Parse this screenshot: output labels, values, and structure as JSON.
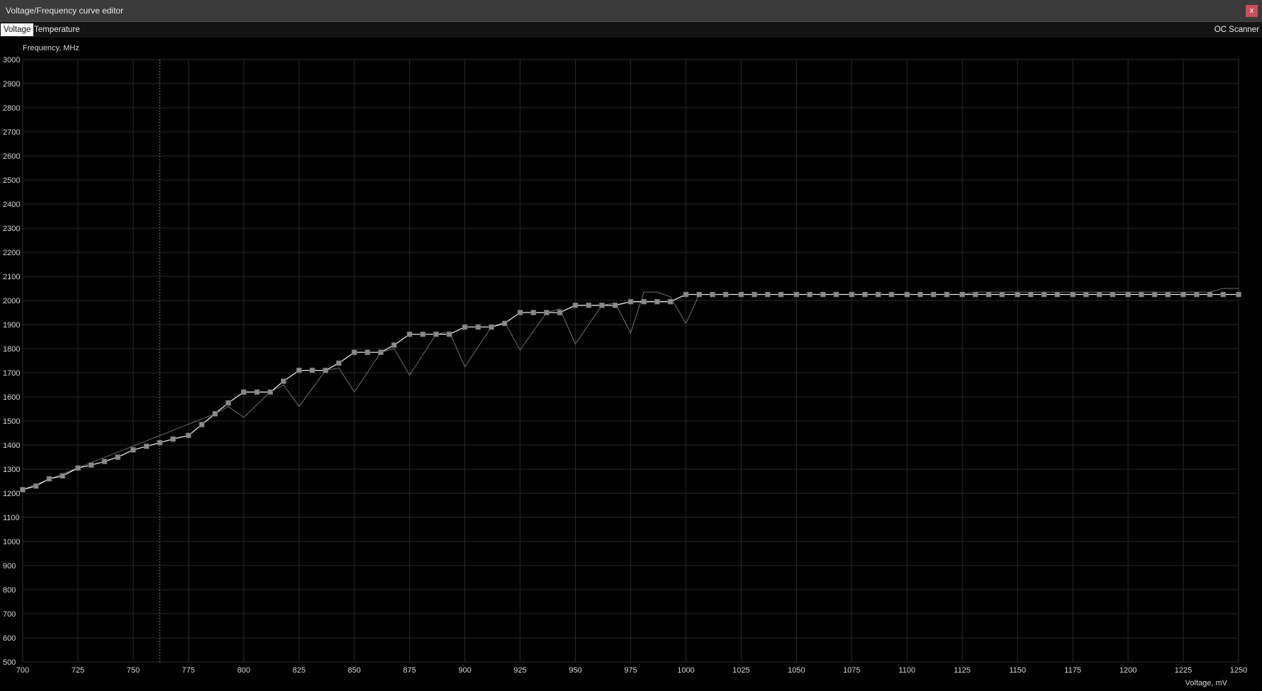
{
  "window": {
    "title": "Voltage/Frequency curve editor",
    "close_label": "x"
  },
  "tabs": [
    {
      "label": "Voltage",
      "active": true
    },
    {
      "label": "Temperature",
      "active": false
    }
  ],
  "oc_scanner_label": "OC Scanner",
  "colors": {
    "background": "#000000",
    "titlebar": "#3b3b3b",
    "close_button": "#c8505a",
    "grid": "#2a2a2a",
    "curve": "#e8e8e8",
    "marker": "#8a8a8a",
    "reference_curve": "#6e6e6e"
  },
  "chart_data": {
    "type": "line",
    "title": "",
    "xlabel": "Voltage, mV",
    "ylabel": "Frequency, MHz",
    "xlim": [
      700,
      1250
    ],
    "ylim": [
      500,
      3000
    ],
    "x_ticks": [
      700,
      725,
      750,
      775,
      800,
      825,
      850,
      875,
      900,
      925,
      950,
      975,
      1000,
      1025,
      1050,
      1075,
      1100,
      1125,
      1150,
      1175,
      1200,
      1225,
      1250
    ],
    "y_ticks": [
      3000,
      2900,
      2800,
      2700,
      2600,
      2500,
      2400,
      2300,
      2200,
      2100,
      2000,
      1900,
      1800,
      1700,
      1600,
      1500,
      1400,
      1300,
      1200,
      1100,
      1000,
      900,
      800,
      700,
      600,
      500
    ],
    "grid": true,
    "cursor_voltage": 762,
    "series": [
      {
        "name": "",
        "role": "curve",
        "markers": true,
        "x": [
          700,
          706,
          712,
          718,
          725,
          731,
          737,
          743,
          750,
          756,
          762,
          768,
          775,
          781,
          787,
          793,
          800,
          806,
          812,
          818,
          825,
          831,
          837,
          843,
          850,
          856,
          862,
          868,
          875,
          881,
          887,
          893,
          900,
          906,
          912,
          918,
          925,
          931,
          937,
          943,
          950,
          956,
          962,
          968,
          975,
          981,
          987,
          993,
          1000,
          1006,
          1012,
          1018,
          1025,
          1031,
          1037,
          1043,
          1050,
          1056,
          1062,
          1068,
          1075,
          1081,
          1087,
          1093,
          1100,
          1106,
          1112,
          1118,
          1125,
          1131,
          1137,
          1143,
          1150,
          1156,
          1162,
          1168,
          1175,
          1181,
          1187,
          1193,
          1200,
          1206,
          1212,
          1218,
          1225,
          1231,
          1237,
          1243,
          1250
        ],
        "y": [
          1215,
          1230,
          1260,
          1272,
          1305,
          1317,
          1332,
          1350,
          1380,
          1395,
          1410,
          1425,
          1440,
          1485,
          1530,
          1575,
          1620,
          1620,
          1620,
          1665,
          1710,
          1710,
          1710,
          1740,
          1785,
          1785,
          1785,
          1815,
          1860,
          1860,
          1860,
          1860,
          1890,
          1890,
          1890,
          1905,
          1950,
          1950,
          1950,
          1950,
          1980,
          1980,
          1980,
          1980,
          1995,
          1995,
          1995,
          1995,
          2025,
          2025,
          2025,
          2025,
          2025,
          2025,
          2025,
          2025,
          2025,
          2025,
          2025,
          2025,
          2025,
          2025,
          2025,
          2025,
          2025,
          2025,
          2025,
          2025,
          2025,
          2025,
          2025,
          2025,
          2025,
          2025,
          2025,
          2025,
          2025,
          2025,
          2025,
          2025,
          2025,
          2025,
          2025,
          2025,
          2025,
          2025,
          2025,
          2025,
          2025
        ]
      },
      {
        "name": "",
        "role": "reference",
        "markers": false,
        "x": [
          700,
          787,
          793,
          800,
          812,
          818,
          825,
          837,
          843,
          850,
          862,
          868,
          875,
          887,
          893,
          900,
          912,
          918,
          925,
          937,
          943,
          950,
          962,
          968,
          975,
          981,
          987,
          993,
          1000,
          1006,
          1125,
          1131,
          1237,
          1243,
          1250
        ],
        "y": [
          1215,
          1530,
          1560,
          1515,
          1620,
          1650,
          1560,
          1710,
          1720,
          1620,
          1785,
          1800,
          1690,
          1860,
          1870,
          1725,
          1890,
          1910,
          1795,
          1950,
          1965,
          1820,
          1980,
          1990,
          1865,
          2035,
          2035,
          2015,
          1905,
          2025,
          2025,
          2035,
          2035,
          2050,
          2050
        ]
      }
    ]
  }
}
